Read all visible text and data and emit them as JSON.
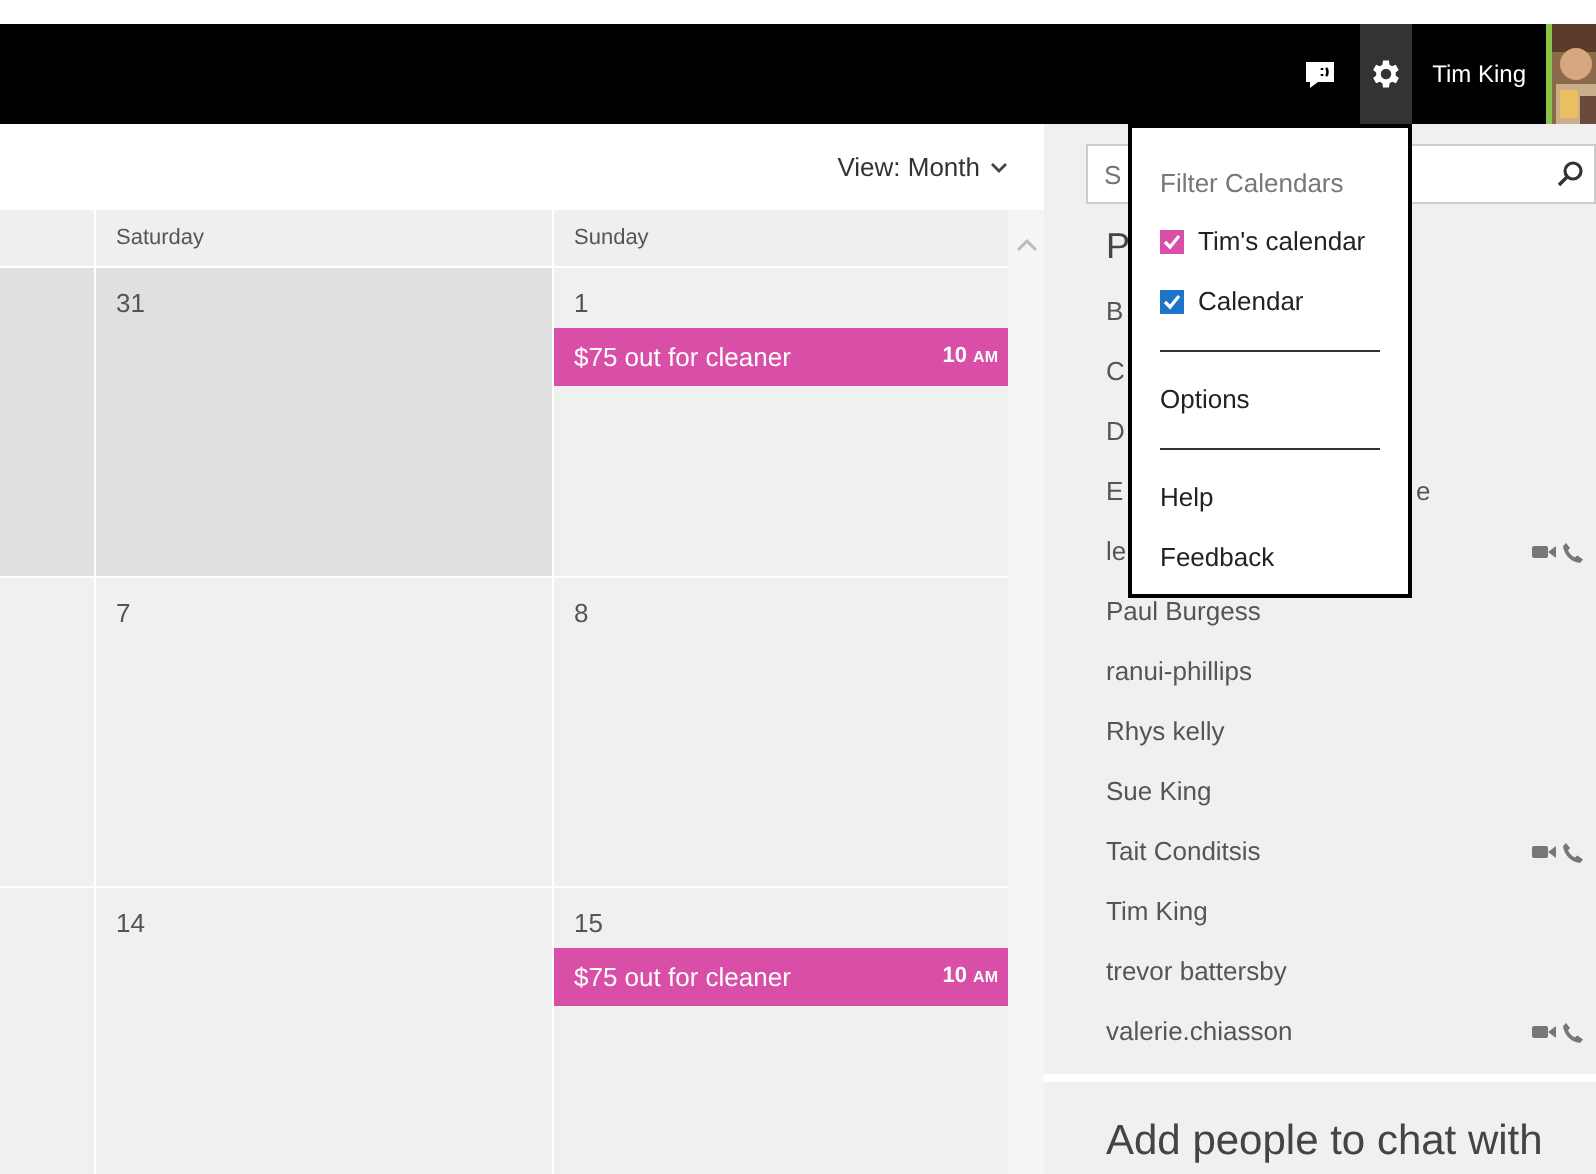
{
  "top_bar": {
    "user_name": "Tim King"
  },
  "view_selector": {
    "label": "View: Month"
  },
  "calendar": {
    "columns": [
      "Saturday",
      "Sunday"
    ],
    "weeks": [
      {
        "days": [
          {
            "out_of_month": true
          },
          {
            "date": "31",
            "out_of_month": true
          },
          {
            "date": "1",
            "out_of_month": false,
            "events": [
              {
                "title": "$75 out for cleaner",
                "time": "10",
                "meridiem": "AM",
                "color": "#d94fa8"
              }
            ]
          }
        ]
      },
      {
        "days": [
          {
            "out_of_month": false
          },
          {
            "date": "7",
            "out_of_month": false
          },
          {
            "date": "8",
            "out_of_month": false
          }
        ]
      },
      {
        "days": [
          {
            "out_of_month": false
          },
          {
            "date": "14",
            "out_of_month": false
          },
          {
            "date": "15",
            "out_of_month": false,
            "events": [
              {
                "title": "$75 out for cleaner",
                "time": "10",
                "meridiem": "AM",
                "color": "#d94fa8"
              }
            ]
          }
        ]
      }
    ]
  },
  "people": {
    "search": {
      "placeholder": "S"
    },
    "heading": "P",
    "contacts": [
      {
        "name": "B",
        "calls": false
      },
      {
        "name": "C",
        "calls": false
      },
      {
        "name": "D",
        "calls": false
      },
      {
        "name": "E",
        "tail": "e",
        "calls": false
      },
      {
        "name": "le",
        "calls": true
      },
      {
        "name": "Paul Burgess",
        "calls": false
      },
      {
        "name": "ranui-phillips",
        "calls": false
      },
      {
        "name": "Rhys kelly",
        "calls": false
      },
      {
        "name": "Sue King",
        "calls": false
      },
      {
        "name": "Tait Conditsis",
        "calls": true
      },
      {
        "name": "Tim King",
        "calls": false
      },
      {
        "name": "trevor battersby",
        "calls": false
      },
      {
        "name": "valerie.chiasson",
        "calls": true
      }
    ],
    "add_prompt": "Add people to chat with"
  },
  "settings_menu": {
    "section_title": "Filter Calendars",
    "calendars": [
      {
        "label": "Tim's calendar",
        "checked": true,
        "color": "#d94fa8"
      },
      {
        "label": "Calendar",
        "checked": true,
        "color": "#1e74c8"
      }
    ],
    "items": [
      {
        "label": "Options",
        "divider_before": true
      },
      {
        "label": "Help",
        "divider_before": true
      },
      {
        "label": "Feedback",
        "divider_before": false
      }
    ]
  }
}
